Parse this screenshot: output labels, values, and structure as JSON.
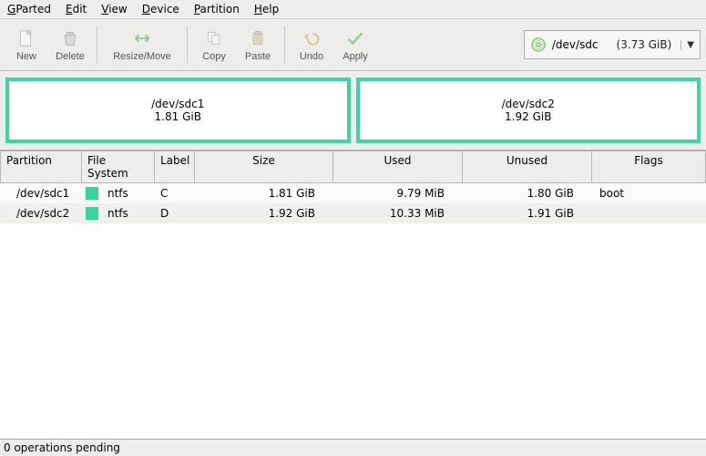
{
  "menus": {
    "gparted": "GParted",
    "edit": "Edit",
    "view": "View",
    "device": "Device",
    "partition": "Partition",
    "help": "Help"
  },
  "toolbar": {
    "new": "New",
    "delete": "Delete",
    "resize": "Resize/Move",
    "copy": "Copy",
    "paste": "Paste",
    "undo": "Undo",
    "apply": "Apply"
  },
  "device": {
    "path": "/dev/sdc",
    "size": "(3.73 GiB)"
  },
  "diskmap": [
    {
      "name": "/dev/sdc1",
      "size": "1.81 GiB"
    },
    {
      "name": "/dev/sdc2",
      "size": "1.92 GiB"
    }
  ],
  "columns": {
    "partition": "Partition",
    "fs": "File System",
    "label": "Label",
    "size": "Size",
    "used": "Used",
    "unused": "Unused",
    "flags": "Flags"
  },
  "rows": [
    {
      "partition": "/dev/sdc1",
      "fs": "ntfs",
      "label": "C",
      "size": "1.81 GiB",
      "used": "9.79 MiB",
      "unused": "1.80 GiB",
      "flags": "boot"
    },
    {
      "partition": "/dev/sdc2",
      "fs": "ntfs",
      "label": "D",
      "size": "1.92 GiB",
      "used": "10.33 MiB",
      "unused": "1.91 GiB",
      "flags": ""
    }
  ],
  "status": "0 operations pending"
}
